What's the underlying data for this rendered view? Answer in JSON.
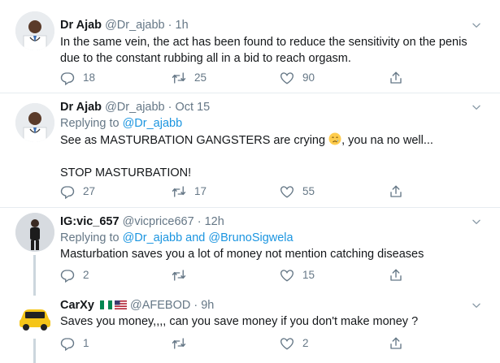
{
  "tweets": [
    {
      "name": "Dr Ajab",
      "handle": "@Dr_ajabb",
      "dot": "·",
      "time": "1h",
      "text": "In the same vein, the act has been found to reduce the sensitivity on the penis due to the constant rubbing all in a bid to reach orgasm.",
      "replies": "18",
      "retweets": "25",
      "likes": "90"
    },
    {
      "name": "Dr Ajab",
      "handle": "@Dr_ajabb",
      "dot": "·",
      "time": "Oct 15",
      "replying_prefix": "Replying to",
      "replying_to": "@Dr_ajabb",
      "text_line1a": "See as MASTURBATION GANGSTERS are crying",
      "text_line1b": ", you na no well...",
      "text_line2": "STOP MASTURBATION!",
      "replies": "27",
      "retweets": "17",
      "likes": "55"
    },
    {
      "name": "IG:vic_657",
      "handle": "@vicprice667",
      "dot": "·",
      "time": "12h",
      "replying_prefix": "Replying to",
      "replying_to_1": "@Dr_ajabb",
      "replying_and": "and",
      "replying_to_2": "@BrunoSigwela",
      "text": "Masturbation saves you a lot of money not mention catching diseases",
      "replies": "2",
      "retweets": "",
      "likes": "15"
    },
    {
      "name": "CarXy",
      "handle": "@AFEBOD",
      "dot": "·",
      "time": "9h",
      "text": "Saves you money,,,, can you save money if you don't make money ?",
      "replies": "1",
      "retweets": "",
      "likes": "2"
    }
  ],
  "icons": {
    "reply": "reply-icon",
    "retweet": "retweet-icon",
    "like": "heart-icon",
    "share": "share-icon",
    "more": "chevron-down-icon"
  },
  "colors": {
    "text": "#14171a",
    "muted": "#657786",
    "link": "#1b95e0",
    "divider": "#e6ecf0",
    "thread": "#ccd6dd"
  }
}
